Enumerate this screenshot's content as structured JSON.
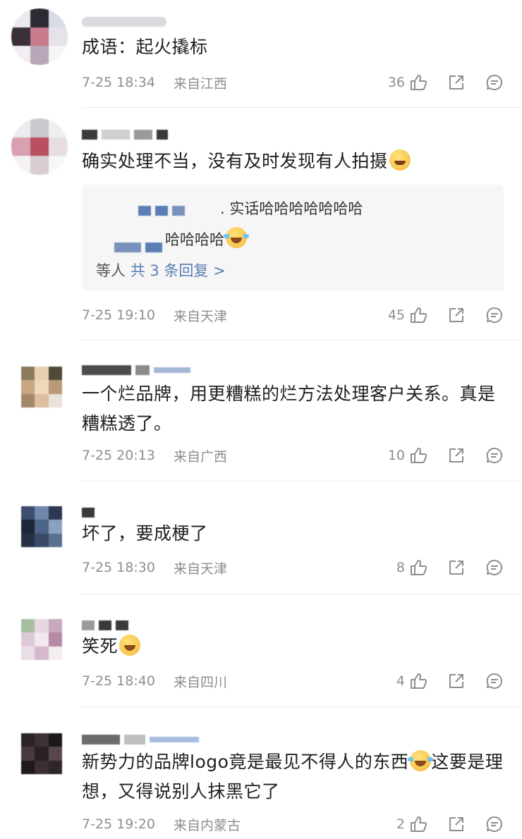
{
  "comments": [
    {
      "text": "成语：起火撬标",
      "time": "7-25 18:34",
      "location": "来自江西",
      "likes": "36"
    },
    {
      "text": "确实处理不当，没有及时发现有人拍摄",
      "emoji": "upside-down-face-emoji",
      "reply": {
        "line1": ". 实话哈哈哈哈哈哈哈",
        "line2": "哈哈哈哈",
        "line2_emoji": "tears-of-joy-emoji",
        "more_prefix": "等人",
        "more_link": "共 3 条回复 >"
      },
      "time": "7-25 19:10",
      "location": "来自天津",
      "likes": "45"
    },
    {
      "text": "一个烂品牌，用更糟糕的烂方法处理客户关系。真是糟糕透了。",
      "time": "7-25 20:13",
      "location": "来自广西",
      "likes": "10"
    },
    {
      "text": "坏了，要成梗了",
      "time": "7-25 18:30",
      "location": "来自天津",
      "likes": "8"
    },
    {
      "text": "笑死",
      "emoji": "grinning-face-emoji",
      "time": "7-25 18:40",
      "location": "来自四川",
      "likes": "4"
    },
    {
      "text_part1": "新势力的品牌logo竟是最见不得人的东西",
      "emoji": "tears-of-joy-emoji",
      "text_part2": "这要是理想，又得说别人抹黑它了",
      "time": "7-25 19:20",
      "location": "来自内蒙古",
      "likes": "2"
    }
  ],
  "icons": {
    "like": "thumbs-up-icon",
    "share": "share-icon",
    "comment": "comment-icon"
  },
  "colors": {
    "link": "#5b7eb5",
    "meta": "#8e8e8e",
    "reply_bg": "#f6f6f6"
  }
}
